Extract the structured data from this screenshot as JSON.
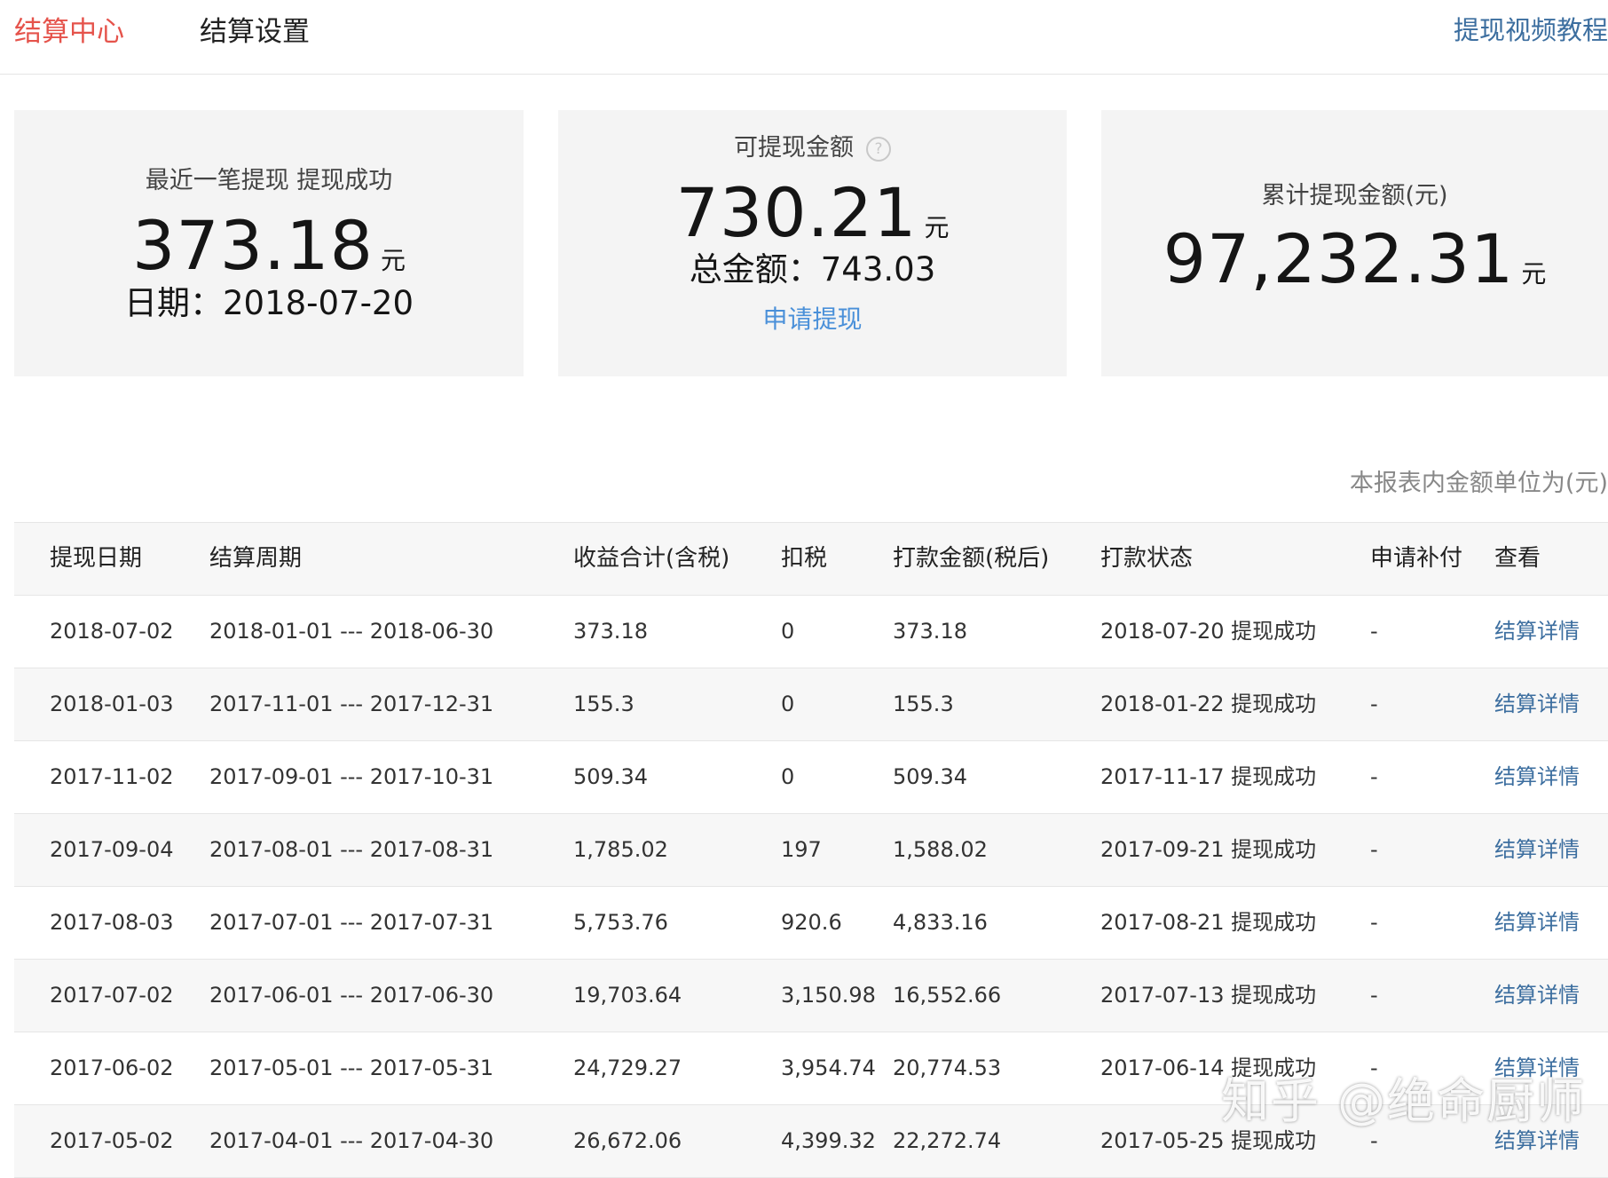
{
  "tabs": [
    {
      "label": "结算中心",
      "active": true
    },
    {
      "label": "结算设置",
      "active": false
    }
  ],
  "tutorial_link": "提现视频教程",
  "cards": {
    "recent": {
      "label": "最近一笔提现 提现成功",
      "amount": "373.18",
      "unit": "元",
      "date_text": "日期：2018-07-20"
    },
    "available": {
      "label": "可提现金额",
      "help_icon": "question-circle-icon",
      "amount": "730.21",
      "unit": "元",
      "total_text": "总金额：743.03",
      "apply_link": "申请提现"
    },
    "cumulative": {
      "label": "累计提现金额(元)",
      "amount": "97,232.31",
      "unit": "元"
    }
  },
  "unit_note": "本报表内金额单位为(元)",
  "table": {
    "headers": [
      "提现日期",
      "结算周期",
      "收益合计(含税)",
      "扣税",
      "打款金额(税后)",
      "打款状态",
      "申请补付",
      "查看"
    ],
    "rows": [
      [
        "2018-07-02",
        "2018-01-01 --- 2018-06-30",
        "373.18",
        "0",
        "373.18",
        "2018-07-20 提现成功",
        "-",
        "结算详情"
      ],
      [
        "2018-01-03",
        "2017-11-01 --- 2017-12-31",
        "155.3",
        "0",
        "155.3",
        "2018-01-22 提现成功",
        "-",
        "结算详情"
      ],
      [
        "2017-11-02",
        "2017-09-01 --- 2017-10-31",
        "509.34",
        "0",
        "509.34",
        "2017-11-17 提现成功",
        "-",
        "结算详情"
      ],
      [
        "2017-09-04",
        "2017-08-01 --- 2017-08-31",
        "1,785.02",
        "197",
        "1,588.02",
        "2017-09-21 提现成功",
        "-",
        "结算详情"
      ],
      [
        "2017-08-03",
        "2017-07-01 --- 2017-07-31",
        "5,753.76",
        "920.6",
        "4,833.16",
        "2017-08-21 提现成功",
        "-",
        "结算详情"
      ],
      [
        "2017-07-02",
        "2017-06-01 --- 2017-06-30",
        "19,703.64",
        "3,150.98",
        "16,552.66",
        "2017-07-13 提现成功",
        "-",
        "结算详情"
      ],
      [
        "2017-06-02",
        "2017-05-01 --- 2017-05-31",
        "24,729.27",
        "3,954.74",
        "20,774.53",
        "2017-06-14 提现成功",
        "-",
        "结算详情"
      ],
      [
        "2017-05-02",
        "2017-04-01 --- 2017-04-30",
        "26,672.06",
        "4,399.32",
        "22,272.74",
        "2017-05-25 提现成功",
        "-",
        "结算详情"
      ]
    ]
  },
  "watermark": "知乎 @绝命厨师"
}
